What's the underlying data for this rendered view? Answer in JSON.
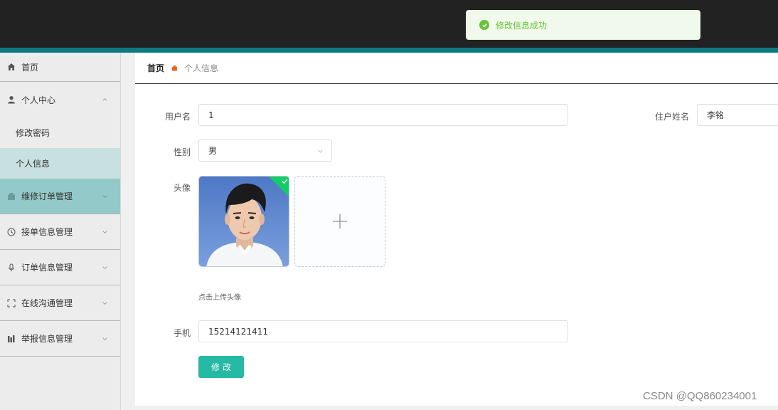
{
  "toast": {
    "message": "修改信息成功",
    "color": "#67c23a"
  },
  "sidebar": {
    "home": {
      "label": "首页",
      "icon": "home-icon"
    },
    "groups": [
      {
        "label": "个人中心",
        "icon": "user-icon",
        "expanded": true,
        "children": [
          {
            "label": "修改密码"
          },
          {
            "label": "个人信息",
            "active": true
          }
        ]
      },
      {
        "label": "维修订单管理",
        "icon": "briefcase-icon",
        "highlighted": true
      },
      {
        "label": "接单信息管理",
        "icon": "clock-icon"
      },
      {
        "label": "订单信息管理",
        "icon": "microphone-icon"
      },
      {
        "label": "在线沟通管理",
        "icon": "fullscreen-icon"
      },
      {
        "label": "举报信息管理",
        "icon": "chart-icon"
      }
    ]
  },
  "breadcrumb": {
    "home": "首页",
    "current": "个人信息"
  },
  "form": {
    "username": {
      "label": "用户名",
      "value": "1"
    },
    "resident_name": {
      "label": "住户姓名",
      "value": "李铭"
    },
    "gender": {
      "label": "性别",
      "value": "男"
    },
    "avatar": {
      "label": "头像",
      "tip": "点击上传头像"
    },
    "phone": {
      "label": "手机",
      "value": "15214121411"
    },
    "submit_label": "修改"
  },
  "colors": {
    "accent": "#26b9a3",
    "topbar": "#222222",
    "topbar_stripe": "#0e7a80"
  },
  "watermark": "CSDN @QQ860234001"
}
